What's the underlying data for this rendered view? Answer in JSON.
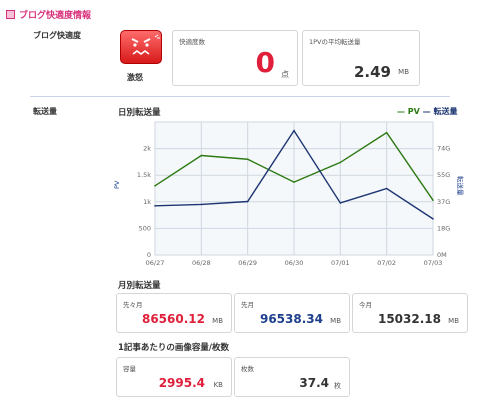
{
  "header": {
    "title": "ブログ快適度情報"
  },
  "comfort": {
    "label": "ブログ快適度",
    "status_text": "激怒",
    "speed": {
      "caption": "快適度数",
      "value": "0",
      "unit": "点"
    },
    "avg_transfer": {
      "caption": "1PVの平均転送量",
      "value": "2.49",
      "unit": "MB"
    }
  },
  "transfer": {
    "label": "転送量",
    "daily_title": "日別転送量",
    "legend": {
      "pv": "PV",
      "transfer": "転送量"
    },
    "monthly_title": "月別転送量",
    "monthly": [
      {
        "caption": "先々月",
        "value": "86560.12",
        "unit": "MB",
        "color": "#e0203a"
      },
      {
        "caption": "先月",
        "value": "96538.34",
        "unit": "MB",
        "color": "#1d3f8c"
      },
      {
        "caption": "今月",
        "value": "15032.18",
        "unit": "MB",
        "color": "#333333"
      }
    ],
    "per_post_title": "1記事あたりの画像容量/枚数",
    "per_post": [
      {
        "caption": "容量",
        "value": "2995.4",
        "unit": "KB",
        "color": "#e0203a"
      },
      {
        "caption": "枚数",
        "value": "37.4",
        "unit": "枚",
        "color": "#333333"
      }
    ]
  },
  "colors": {
    "pv": "#2d7a12",
    "transfer": "#1d3572",
    "accent": "#d8307a"
  },
  "chart_data": {
    "type": "line",
    "title": "日別転送量",
    "categories": [
      "06/27",
      "06/28",
      "06/29",
      "06/30",
      "07/01",
      "07/02",
      "07/03"
    ],
    "series": [
      {
        "name": "PV",
        "axis": "left",
        "values": [
          1300,
          1870,
          1800,
          1370,
          1740,
          2300,
          1030
        ]
      },
      {
        "name": "転送量",
        "axis": "right",
        "values": [
          34,
          35,
          37,
          86,
          36,
          46,
          25
        ]
      }
    ],
    "y_left": {
      "label": "PV",
      "ticks": [
        "0",
        "500",
        "1k",
        "1.5k",
        "2k"
      ],
      "range": [
        0,
        2500
      ]
    },
    "y_right": {
      "label": "転送量",
      "ticks": [
        "0M",
        "18G",
        "37G",
        "55G",
        "74G"
      ],
      "range": [
        0,
        92
      ]
    },
    "grid": true,
    "legend_position": "top-right"
  }
}
